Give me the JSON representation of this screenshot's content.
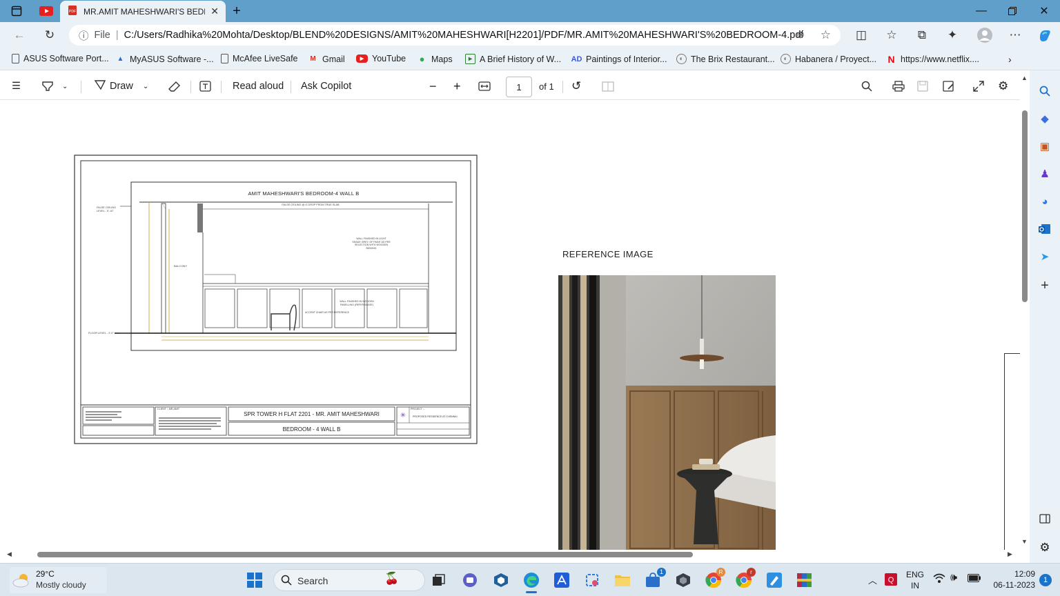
{
  "browser": {
    "tab_title": "MR.AMIT MAHESHWARI'S BEDR(",
    "file_label": "File",
    "url": "C:/Users/Radhika%20Mohta/Desktop/BLEND%20DESIGNS/AMIT%20MAHESHWARI[H2201]/PDF/MR.AMIT%20MAHESHWARI'S%20BEDROOM-4.pdf"
  },
  "bookmarks": [
    {
      "label": "ASUS Software Port...",
      "icon": "page-icon"
    },
    {
      "label": "MyASUS Software -...",
      "icon": "asus-logo-icon"
    },
    {
      "label": "McAfee LiveSafe",
      "icon": "page-icon"
    },
    {
      "label": "Gmail",
      "icon": "gmail-icon"
    },
    {
      "label": "YouTube",
      "icon": "youtube-icon"
    },
    {
      "label": "Maps",
      "icon": "maps-icon"
    },
    {
      "label": "A Brief History of W...",
      "icon": "site-icon"
    },
    {
      "label": "Paintings of Interior...",
      "icon": "ad-icon"
    },
    {
      "label": "The Brix Restaurant...",
      "icon": "globe-icon"
    },
    {
      "label": "Habanera / Proyect...",
      "icon": "globe-icon"
    },
    {
      "label": "https://www.netflix....",
      "icon": "netflix-icon"
    }
  ],
  "pdf_toolbar": {
    "draw_label": "Draw",
    "read_aloud_label": "Read aloud",
    "ask_copilot_label": "Ask Copilot",
    "page_number": "1",
    "page_total": "of 1"
  },
  "drawing": {
    "title": "AMIT MAHESHWARI'S BEDROOM-4 WALL B",
    "false_ceiling_note": "FALSE CEILING @ 6' DROP FROM TRUE SLAB",
    "false_ceiling_level": "FALSE CEILING LEVEL - 9'-10\"",
    "floor_level": "FLOOR LEVEL - 0'-0\"",
    "balcony": "BALCONY",
    "wall_note": "WALL FINISHED IN LIGHT SHADE GREY, OF PAINT AS PER SELECTION WITH WOODEN BIDDING",
    "panel_note": "WALL FINISHED IN WOODEN PANELLING (REFER IMAGE)",
    "chair_note": "ACCENT CHAIR AS PER REFERENCE",
    "project_line": "SPR TOWER H FLAT 2201 - MR. AMIT MAHESHWARI",
    "sheet_name": "BEDROOM - 4 WALL B",
    "client_label": "CLIENT :- MR.AMIT",
    "project_label": "PROJECT :-",
    "project_value": "PROPOSED RESIDENCE AT CHENNAI"
  },
  "reference": {
    "label": "REFERENCE IMAGE"
  },
  "taskbar": {
    "temperature": "29°C",
    "weather": "Mostly cloudy",
    "search_placeholder": "Search",
    "lang_top": "ENG",
    "lang_bottom": "IN",
    "time": "12:09",
    "date": "06-11-2023",
    "notification_count": "1"
  },
  "colors": {
    "titlebar": "#5f9fc9",
    "chrome": "#eaf1f7",
    "taskbar": "#dbe6ef",
    "edge_blue": "#1a73c8"
  }
}
